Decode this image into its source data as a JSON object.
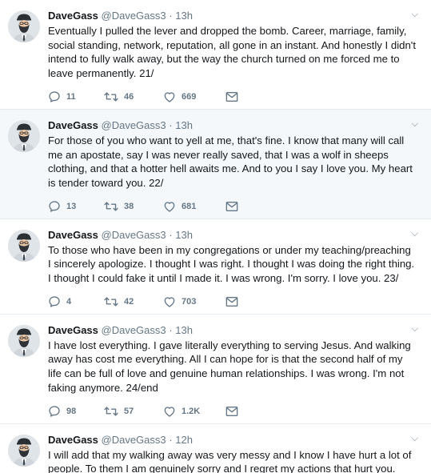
{
  "colors": {
    "text": "#14171a",
    "secondary": "#657786",
    "divider": "#e6ecf0",
    "highlight_bg": "#f5f8fa"
  },
  "icons": {
    "reply": "reply-icon",
    "retweet": "retweet-icon",
    "like": "heart-icon",
    "dm": "envelope-icon",
    "caret": "chevron-down-icon"
  },
  "tweets": [
    {
      "name": "DaveGass",
      "handle": "@DaveGass3",
      "dot": "·",
      "time": "13h",
      "text": "Eventually I pulled the lever and dropped the bomb. Career, marriage, family, social standing, network, reputation, all gone in an instant. And honestly I didn't intend to fully walk away, but the way the church turned on me forced me to leave permanently. 21/",
      "replies": "11",
      "retweets": "46",
      "likes": "669"
    },
    {
      "name": "DaveGass",
      "handle": "@DaveGass3",
      "dot": "·",
      "time": "13h",
      "text": "For those of you who want to yell at me, that's fine. I know that many will call me an apostate, say I was never really saved, that I was a wolf in sheeps clothing, and that a hotter hell awaits me. And to you I say I love you. My heart is tender toward you. 22/",
      "replies": "13",
      "retweets": "38",
      "likes": "681"
    },
    {
      "name": "DaveGass",
      "handle": "@DaveGass3",
      "dot": "·",
      "time": "13h",
      "text": "To those who have been in my congregations or under my teaching/preaching I sincerely apologize. I thought I was right. I thought I was doing the right thing. I thought I could fake it until I made it. I was wrong. I'm sorry. I love you. 23/",
      "replies": "4",
      "retweets": "42",
      "likes": "703"
    },
    {
      "name": "DaveGass",
      "handle": "@DaveGass3",
      "dot": "·",
      "time": "13h",
      "text": "I have lost everything. I gave literally everything to serving Jesus. And walking away has cost me everything. All I can hope for is that the second half of my life can be full of love and genuine human relationships. I was wrong. I'm not faking anymore. 24/end",
      "replies": "98",
      "retweets": "57",
      "likes": "1.2K"
    },
    {
      "name": "DaveGass",
      "handle": "@DaveGass3",
      "dot": "·",
      "time": "12h",
      "text": "I will add that my walking away was very messy and I know I have hurt a lot of people. To them I am genuinely sorry and I regret my actions that hurt you."
    }
  ]
}
